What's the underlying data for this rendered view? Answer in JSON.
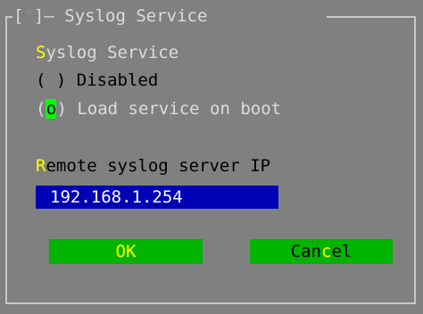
{
  "window": {
    "title_open": "[",
    "title_mark": "*",
    "title_close": "]",
    "title_dash": "—",
    "title": "Syslog Service"
  },
  "section": {
    "label_hot": "S",
    "label_rest": "yslog Service"
  },
  "options": [
    {
      "mark": " ",
      "label": "Disabled",
      "selected": false
    },
    {
      "mark": "o",
      "label": "Load service on boot",
      "selected": true
    }
  ],
  "remote": {
    "label_hot": "R",
    "label_rest": "emote syslog server IP",
    "value": "192.168.1.254"
  },
  "buttons": {
    "ok_label": "OK",
    "cancel_pre": "Can",
    "cancel_hot": "c",
    "cancel_post": "el"
  },
  "colors": {
    "background": "#808080",
    "field": "#0000b4",
    "button": "#00b400",
    "highlight": "#ffff00",
    "radio_active": "#00ff00"
  }
}
